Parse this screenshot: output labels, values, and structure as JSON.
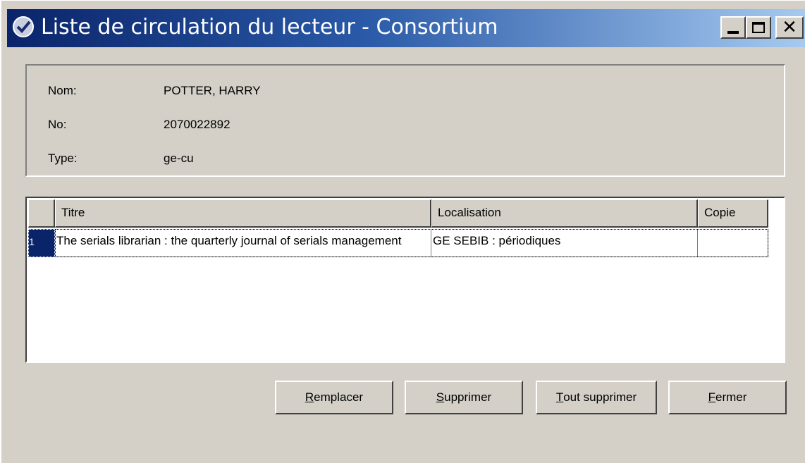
{
  "window": {
    "title": "Liste de circulation du lecteur - Consortium",
    "icon": "library-checkmark-icon"
  },
  "reader": {
    "name_label": "Nom:",
    "name_value": "POTTER, HARRY",
    "number_label": "No:",
    "number_value": "2070022892",
    "type_label": "Type:",
    "type_value": "ge-cu"
  },
  "grid": {
    "columns": [
      "Titre",
      "Localisation",
      "Copie"
    ],
    "rows": [
      {
        "index": "1",
        "title": "The serials librarian : the quarterly journal of serials management",
        "location": "GE SEBIB : périodiques",
        "copy": ""
      }
    ]
  },
  "buttons": {
    "replace": {
      "mnemonic": "R",
      "rest": "emplacer"
    },
    "delete": {
      "mnemonic": "S",
      "rest": "upprimer"
    },
    "delete_all": {
      "mnemonic": "T",
      "rest": "out supprimer"
    },
    "close": {
      "mnemonic": "F",
      "rest": "ermer"
    }
  }
}
